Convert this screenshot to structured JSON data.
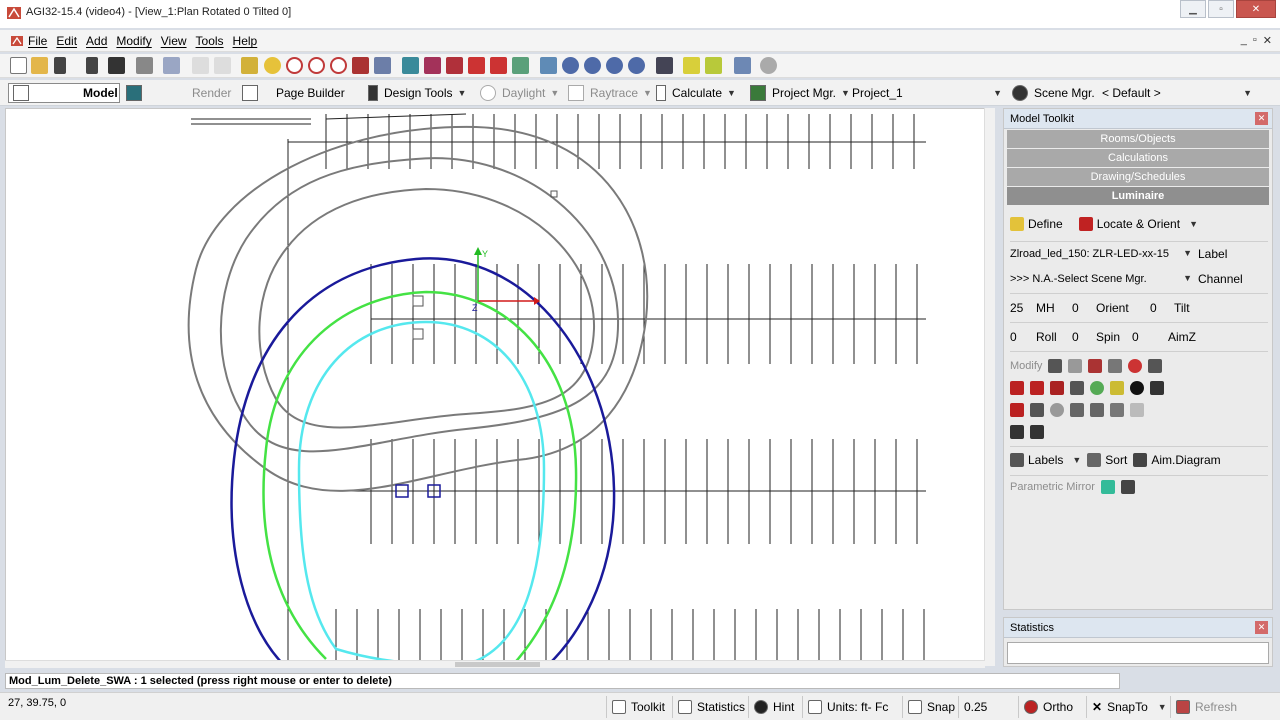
{
  "window": {
    "title": "AGI32-15.4 (video4) - [View_1:Plan Rotated 0 Tilted 0]"
  },
  "menu": [
    "File",
    "Edit",
    "Add",
    "Modify",
    "View",
    "Tools",
    "Help"
  ],
  "mdi_controls": {
    "minimize": "_",
    "restore": "▫",
    "close": "✕"
  },
  "window_controls": {
    "minimize": "▁",
    "restore": "▫",
    "close": "✕"
  },
  "modes": {
    "model": "Model",
    "render": "Render",
    "page_builder": "Page Builder",
    "design_tools": "Design Tools",
    "daylight": "Daylight",
    "raytrace": "Raytrace",
    "calculate": "Calculate",
    "project_mgr": "Project Mgr.",
    "project_name": "Project_1",
    "scene_mgr": "Scene Mgr.",
    "scene_value": "< Default >"
  },
  "viewport": {
    "axis_y": "Y",
    "axis_z": "Z"
  },
  "model_toolkit": {
    "title": "Model Toolkit",
    "categories": [
      "Rooms/Objects",
      "Calculations",
      "Drawing/Schedules",
      "Luminaire"
    ],
    "active_category": "Luminaire",
    "define": "Define",
    "locate_orient": "Locate & Orient",
    "luminaire_select": "Zlroad_led_150: ZLR-LED-xx-15",
    "label_text": "Label",
    "scene_select": ">>> N.A.-Select Scene Mgr.",
    "channel_text": "Channel",
    "mh_value": "25",
    "mh_label": "MH",
    "orient_value": "0",
    "orient_label": "Orient",
    "tilt_value": "0",
    "tilt_label": "Tilt",
    "roll_value": "0",
    "roll_label": "Roll",
    "spin_value": "0",
    "spin_label": "Spin",
    "aimz_value": "0",
    "aimz_label": "AimZ",
    "modify_label": "Modify",
    "labels_btn": "Labels",
    "sort_btn": "Sort",
    "aim_diagram_btn": "Aim.Diagram",
    "parametric_mirror": "Parametric Mirror"
  },
  "statistics_panel": {
    "title": "Statistics"
  },
  "command_line": "Mod_Lum_Delete_SWA :  1 selected (press right mouse or enter to delete)",
  "status": {
    "coords": "27, 39.75, 0",
    "toolkit": "Toolkit",
    "statistics": "Statistics",
    "hint": "Hint",
    "units": "Units: ft- Fc",
    "snap": "Snap",
    "snap_value": "0.25",
    "ortho": "Ortho",
    "snapto": "SnapTo",
    "refresh": "Refresh"
  },
  "colors": {
    "contour_blue": "#1a1a9a",
    "contour_green": "#44e244",
    "contour_cyan": "#55e8ee",
    "contour_grey": "#7a7a7a",
    "axis_red": "#d21a1a",
    "axis_green": "#22bb22"
  }
}
